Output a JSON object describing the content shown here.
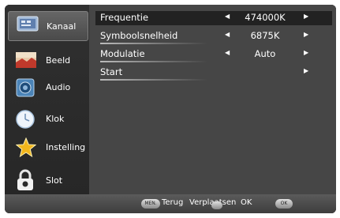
{
  "sidebar": {
    "items": [
      {
        "label": "Kanaal",
        "icon": "tv-channel-icon",
        "active": true
      },
      {
        "label": "Beeld",
        "icon": "picture-icon"
      },
      {
        "label": "Audio",
        "icon": "speaker-icon"
      },
      {
        "label": "Klok",
        "icon": "clock-icon"
      },
      {
        "label": "Instelling",
        "icon": "star-settings-icon"
      },
      {
        "label": "Slot",
        "icon": "lock-icon"
      }
    ]
  },
  "menu": {
    "rows": [
      {
        "label": "Frequentie",
        "value": "474000K",
        "selected": true
      },
      {
        "label": "Symboolsnelheid",
        "value": "6875K"
      },
      {
        "label": "Modulatie",
        "value": "Auto"
      },
      {
        "label": "Start",
        "value": ""
      }
    ]
  },
  "footer": {
    "menu_pill": "MEN.",
    "back_label": "Terug",
    "move_label": "Verplaatsen",
    "ok_pill": "OK",
    "ok_label": "OK"
  },
  "colors": {
    "sidebar_bg": "#2b2b2b",
    "content_bg": "#464646",
    "selected_row_bg": "#222222",
    "text": "#ffffff"
  }
}
